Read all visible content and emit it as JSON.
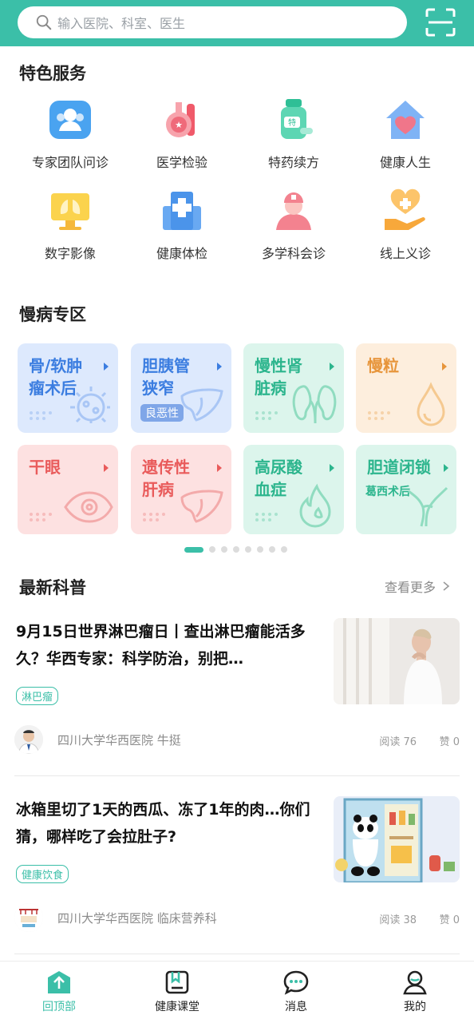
{
  "search": {
    "placeholder": "输入医院、科室、医生"
  },
  "icons": {
    "search": "search-icon",
    "scan": "scan-icon"
  },
  "colors": {
    "accent": "#3bbfa8"
  },
  "featured": {
    "title": "特色服务",
    "items": [
      {
        "label": "专家团队问诊",
        "icon": "expert-team-icon"
      },
      {
        "label": "医学检验",
        "icon": "lab-flask-icon"
      },
      {
        "label": "特药续方",
        "icon": "medicine-bottle-icon"
      },
      {
        "label": "健康人生",
        "icon": "health-house-icon"
      },
      {
        "label": "数字影像",
        "icon": "lung-monitor-icon"
      },
      {
        "label": "健康体检",
        "icon": "hospital-icon"
      },
      {
        "label": "多学科会诊",
        "icon": "doctor-icon"
      },
      {
        "label": "线上义诊",
        "icon": "heart-hand-icon"
      }
    ]
  },
  "chronic": {
    "title": "慢病专区",
    "cards": [
      {
        "line1": "骨/软肿",
        "line2": "瘤术后",
        "sub": "",
        "theme": "blue",
        "deco": "bacteria-icon"
      },
      {
        "line1": "胆胰管",
        "line2": "狭窄",
        "sub": "良恶性",
        "theme": "blue",
        "deco": "liver-icon"
      },
      {
        "line1": "慢性肾",
        "line2": "脏病",
        "sub": "",
        "theme": "green",
        "deco": "kidney-icon"
      },
      {
        "line1": "慢粒",
        "line2": "",
        "sub": "",
        "theme": "orange",
        "deco": "drop-icon"
      },
      {
        "line1": "干眼",
        "line2": "",
        "sub": "",
        "theme": "red",
        "deco": "eye-icon"
      },
      {
        "line1": "遗传性",
        "line2": "肝病",
        "sub": "",
        "theme": "red",
        "deco": "liver-icon"
      },
      {
        "line1": "高尿酸",
        "line2": "血症",
        "sub": "",
        "theme": "green",
        "deco": "flame-icon"
      },
      {
        "line1": "胆道闭锁",
        "line2": "",
        "sub": "葛西术后",
        "theme": "green",
        "deco": "bile-duct-icon"
      }
    ]
  },
  "news": {
    "title": "最新科普",
    "more": "查看更多",
    "articles": [
      {
        "title": "9月15日世界淋巴瘤日丨查出淋巴瘤能活多久？华西专家：科学防治，别把…",
        "tag": "淋巴瘤",
        "source": "四川大学华西医院  牛挺",
        "read": "阅读 76",
        "like": "赞 0"
      },
      {
        "title": "冰箱里切了1天的西瓜、冻了1年的肉…你们猜，哪样吃了会拉肚子?",
        "tag": "健康饮食",
        "source": "四川大学华西医院  临床营养科",
        "read": "阅读 38",
        "like": "赞 0"
      }
    ]
  },
  "pager": {
    "total": 8,
    "active": 1
  },
  "tabbar": [
    {
      "label": "回顶部",
      "icon": "back-to-top-icon",
      "active": true
    },
    {
      "label": "健康课堂",
      "icon": "classroom-icon",
      "active": false
    },
    {
      "label": "消息",
      "icon": "message-icon",
      "active": false
    },
    {
      "label": "我的",
      "icon": "profile-icon",
      "active": false
    }
  ]
}
